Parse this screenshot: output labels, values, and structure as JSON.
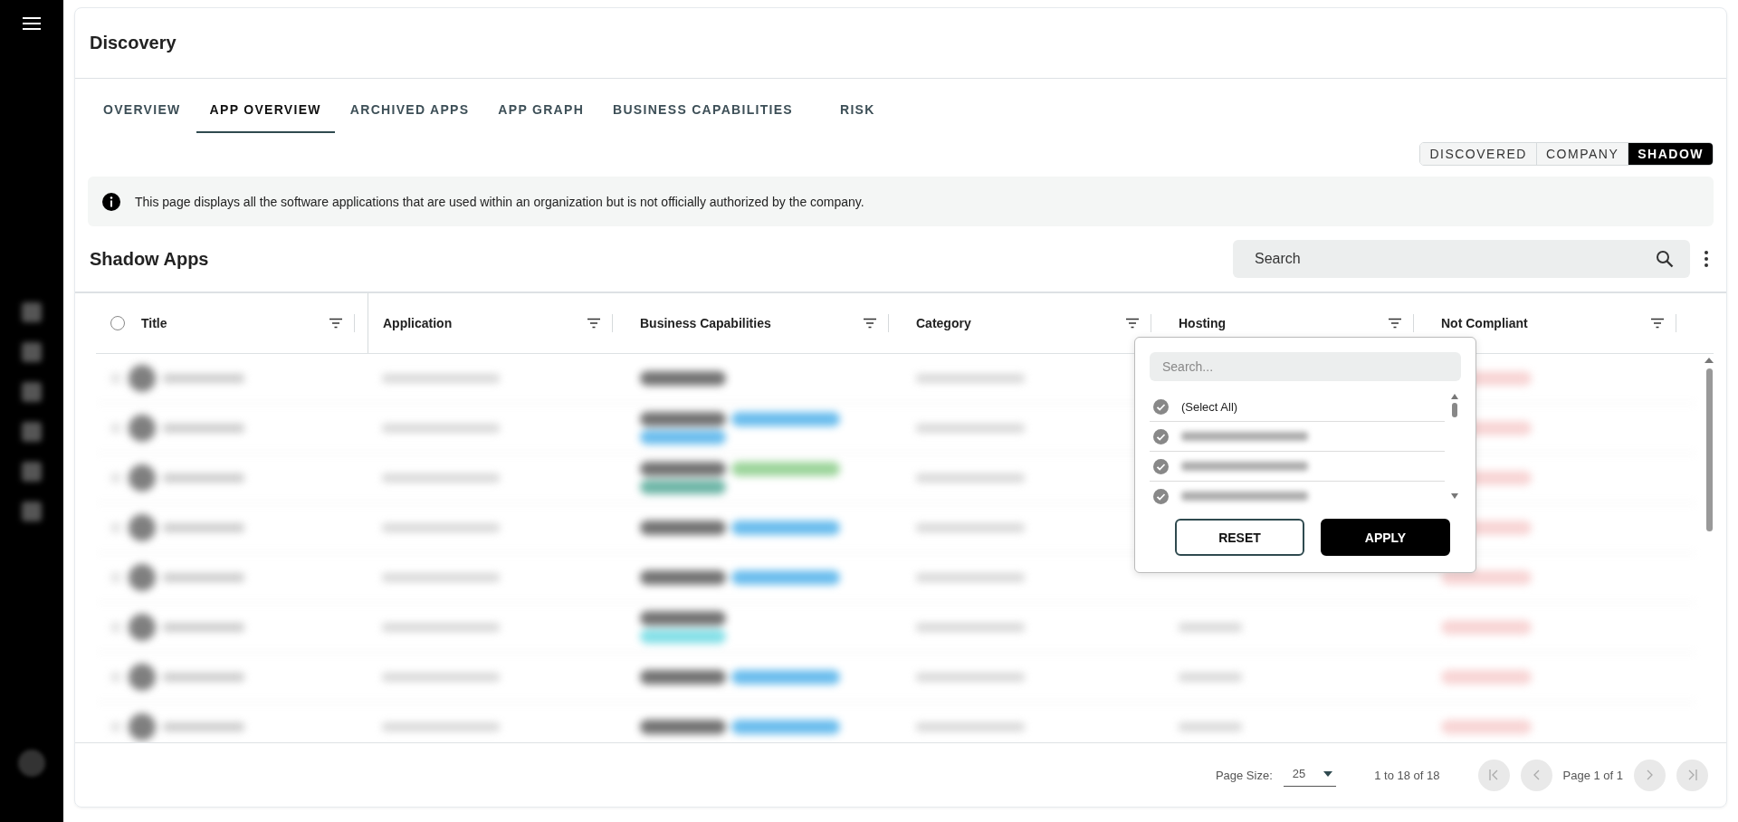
{
  "page": {
    "title": "Discovery"
  },
  "tabs": [
    {
      "label": "OVERVIEW",
      "selected": false
    },
    {
      "label": "APP OVERVIEW",
      "selected": true
    },
    {
      "label": "ARCHIVED APPS",
      "selected": false
    },
    {
      "label": "APP GRAPH",
      "selected": false
    },
    {
      "label": "BUSINESS CAPABILITIES",
      "selected": false
    },
    {
      "label": "RISK",
      "selected": false
    }
  ],
  "view_toggle": [
    {
      "label": "DISCOVERED",
      "selected": false
    },
    {
      "label": "COMPANY",
      "selected": false
    },
    {
      "label": "SHADOW",
      "selected": true
    }
  ],
  "info": {
    "text": "This page displays all the software applications that are used within an organization but is not officially authorized by the company."
  },
  "section": {
    "title": "Shadow Apps",
    "search": {
      "placeholder": "Search"
    }
  },
  "table": {
    "select_all": {
      "checked": false
    },
    "columns": [
      {
        "label": "Title"
      },
      {
        "label": "Application"
      },
      {
        "label": "Business Capabilities"
      },
      {
        "label": "Category"
      },
      {
        "label": "Hosting"
      },
      {
        "label": "Not Compliant"
      }
    ]
  },
  "filter_popup": {
    "search": {
      "placeholder": "Search..."
    },
    "options": [
      {
        "label": "(Select All)",
        "checked": true
      },
      {
        "checked": true
      },
      {
        "checked": true
      },
      {
        "checked": true
      }
    ],
    "buttons": [
      {
        "label": "RESET",
        "kind": "outline"
      },
      {
        "label": "APPLY",
        "kind": "primary"
      }
    ]
  },
  "pagination": {
    "page_size_label": "Page Size:",
    "page_size": "25",
    "range": "1 to 18 of 18",
    "page": "Page 1 of 1"
  }
}
